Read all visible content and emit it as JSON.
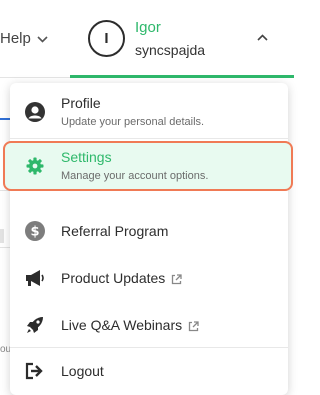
{
  "header": {
    "help_label": "Help",
    "user": {
      "initial": "I",
      "name": "Igor",
      "handle": "syncspajda"
    }
  },
  "menu": {
    "items": [
      {
        "label": "Profile",
        "sublabel": "Update your personal details.",
        "icon": "user-circle-icon"
      },
      {
        "label": "Settings",
        "sublabel": "Manage your account options.",
        "icon": "gear-icon",
        "active": true
      },
      {
        "label": "Referral Program",
        "icon": "dollar-circle-icon"
      },
      {
        "label": "Product Updates",
        "icon": "megaphone-icon",
        "external": true
      },
      {
        "label": "Live Q&A Webinars",
        "icon": "rocket-icon",
        "external": true
      },
      {
        "label": "Logout",
        "icon": "logout-icon"
      }
    ]
  },
  "background": {
    "fragment_text": "ou"
  },
  "colors": {
    "accent_green": "#2eb86b",
    "active_bg": "#e8faf0",
    "highlight_border": "#f07a55"
  }
}
